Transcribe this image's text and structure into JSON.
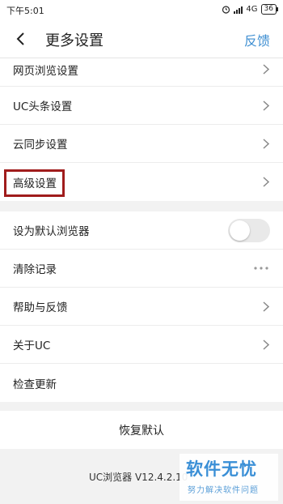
{
  "status_bar": {
    "time": "下午5:01",
    "network": "4G",
    "battery": "36",
    "icons": [
      "alarm-icon",
      "signal-icon",
      "battery-icon"
    ]
  },
  "header": {
    "back_icon": "chevron-left-icon",
    "title": "更多设置",
    "action": "反馈"
  },
  "settings_group1": [
    {
      "label": "网页浏览设置"
    },
    {
      "label": "UC头条设置"
    },
    {
      "label": "云同步设置"
    },
    {
      "label": "高级设置"
    }
  ],
  "settings_group2": [
    {
      "label": "设为默认浏览器",
      "control": "toggle",
      "enabled": false
    },
    {
      "label": "清除记录",
      "control": "more"
    },
    {
      "label": "帮助与反馈",
      "control": "chevron"
    },
    {
      "label": "关于UC",
      "control": "chevron"
    },
    {
      "label": "检查更新",
      "control": "none"
    }
  ],
  "restore_defaults": "恢复默认",
  "version": "UC浏览器 V12.4.2.10",
  "watermark": {
    "title": "软件无忧",
    "subtitle": "努力解决软件问题"
  },
  "colors": {
    "accent": "#3f8fd2",
    "highlight": "#a01c1c",
    "background": "#f2f2f2"
  }
}
